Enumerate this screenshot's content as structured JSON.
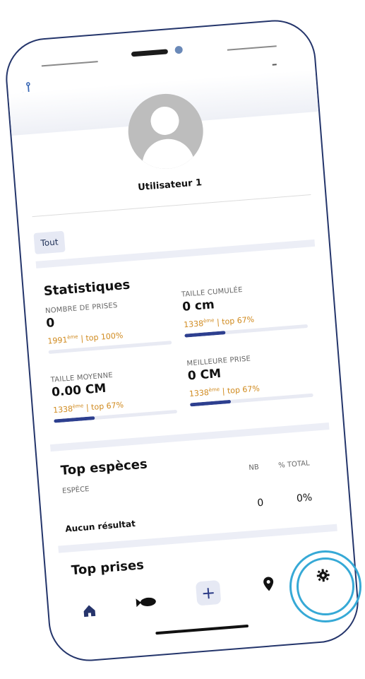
{
  "app": {
    "username": "Utilisateur 1"
  },
  "filter": {
    "label": "Tout"
  },
  "stats": {
    "title": "Statistiques",
    "items": [
      {
        "label": "NOMBRE DE PRISES",
        "value": "0",
        "rank": "1991",
        "rank_suffix": "ème",
        "top": " | top 100%",
        "progress": 0
      },
      {
        "label": "TAILLE CUMULÉE",
        "value": "0 cm",
        "rank": "1338",
        "rank_suffix": "ème",
        "top": " | top 67%",
        "progress": 0.33
      },
      {
        "label": "TAILLE MOYENNE",
        "value": "0.00 CM",
        "rank": "1338",
        "rank_suffix": "ème",
        "top": " | top 67%",
        "progress": 0.33
      },
      {
        "label": "MEILLEURE PRISE",
        "value": "0 CM",
        "rank": "1338",
        "rank_suffix": "ème",
        "top": " | top 67%",
        "progress": 0.33
      }
    ]
  },
  "top_species": {
    "title": "Top espèces",
    "col_species": "ESPÈCE",
    "col_nb": "NB",
    "col_total": "% TOTAL",
    "empty": "Aucun résultat",
    "nb": "0",
    "total": "0%"
  },
  "top_catches": {
    "title": "Top prises"
  },
  "nav": {
    "items": [
      {
        "icon": "home-icon"
      },
      {
        "icon": "fish-icon"
      },
      {
        "icon": "add-icon",
        "glyph": "+"
      },
      {
        "icon": "map-pin-icon"
      },
      {
        "icon": "gear-icon"
      }
    ]
  },
  "colors": {
    "accent": "#2d3f8f",
    "rank": "#d08a1e",
    "highlight_ring": "#36a9d6"
  }
}
